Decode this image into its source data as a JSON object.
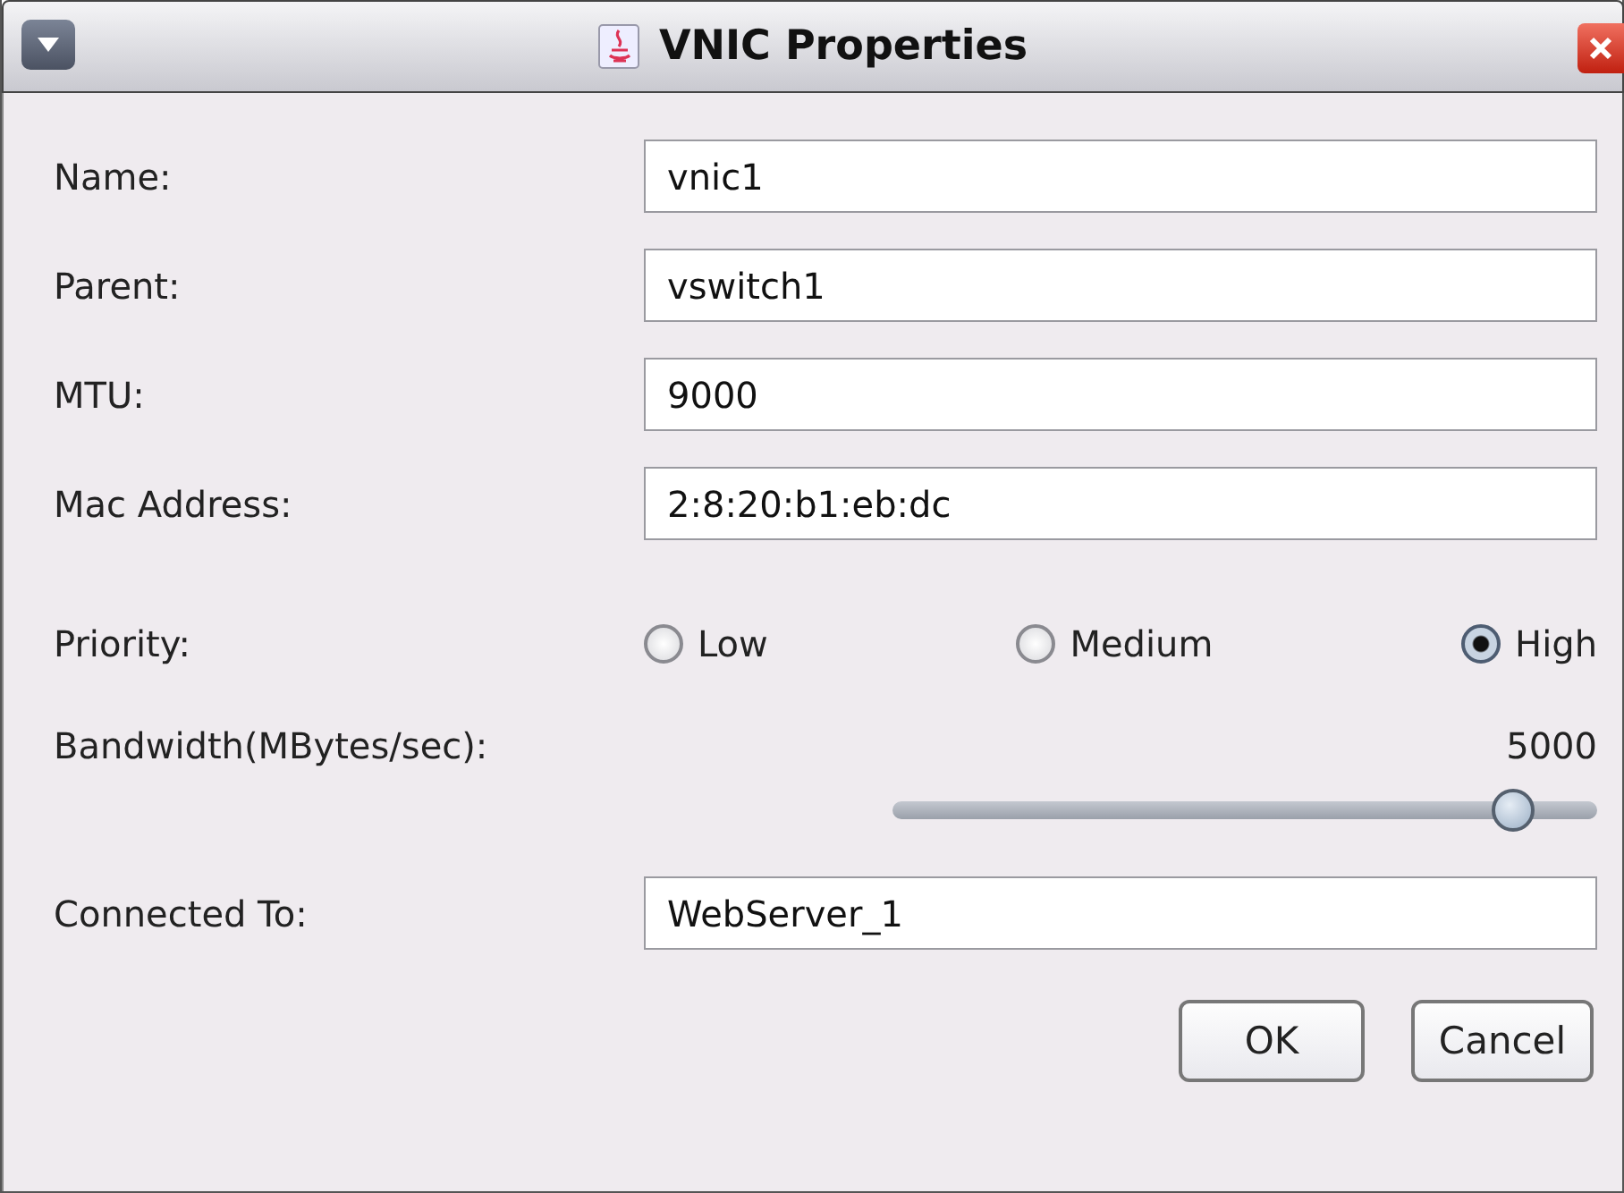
{
  "window": {
    "title": "VNIC Properties"
  },
  "fields": [
    {
      "label": "Name:",
      "value": "vnic1"
    },
    {
      "label": "Parent:",
      "value": "vswitch1"
    },
    {
      "label": "MTU:",
      "value": "9000"
    },
    {
      "label": "Mac Address:",
      "value": "2:8:20:b1:eb:dc"
    }
  ],
  "priority": {
    "label": "Priority:",
    "options": [
      {
        "label": "Low",
        "selected": false
      },
      {
        "label": "Medium",
        "selected": false
      },
      {
        "label": "High",
        "selected": true
      }
    ]
  },
  "bandwidth": {
    "label": "Bandwidth(MBytes/sec):",
    "reading": "5000",
    "level": 0.88
  },
  "connected_to": {
    "label": "Connected To:",
    "value": "WebServer_1"
  },
  "buttons": [
    "OK",
    "Cancel"
  ]
}
